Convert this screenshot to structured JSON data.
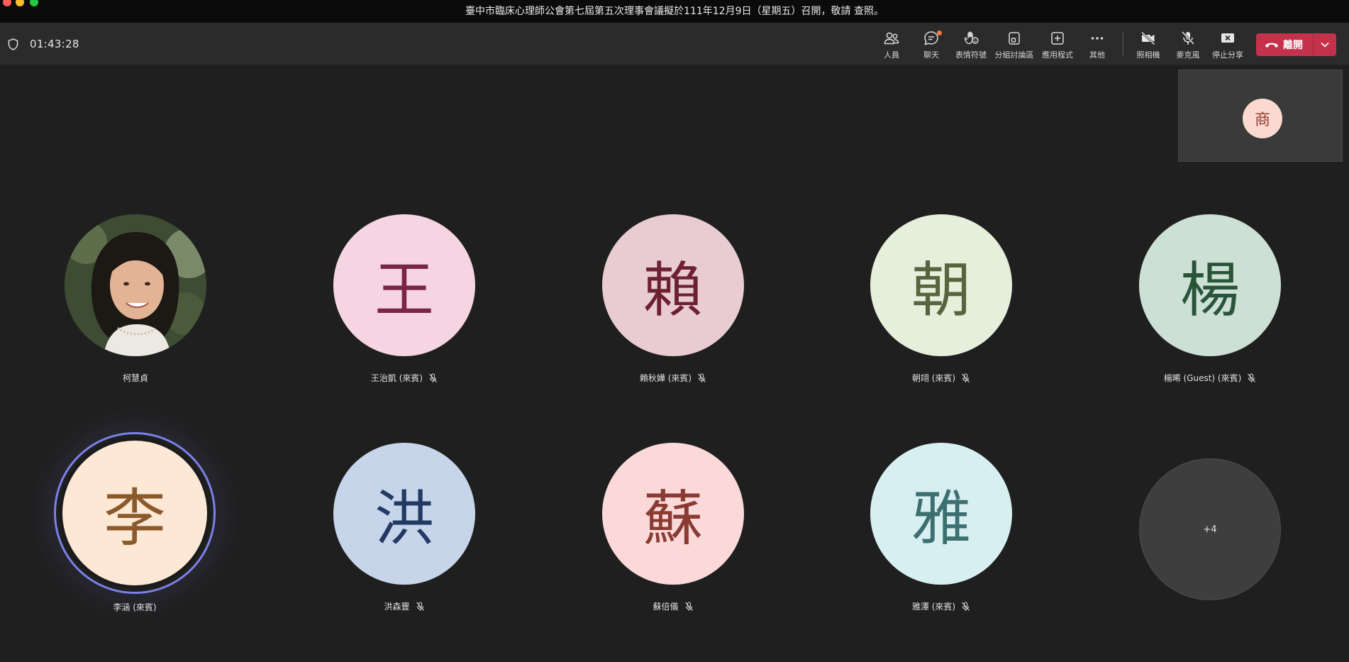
{
  "window": {
    "title": "臺中市臨床心理師公會第七屆第五次理事會議擬於111年12月9日（星期五）召開，敬請 查照。"
  },
  "toolbar": {
    "timer": "01:43:28",
    "items": [
      {
        "label": "人員",
        "icon": "people-icon"
      },
      {
        "label": "聊天",
        "icon": "chat-icon"
      },
      {
        "label": "表情符號",
        "icon": "react-icon"
      },
      {
        "label": "分組討論區",
        "icon": "breakout-rooms-icon"
      },
      {
        "label": "應用程式",
        "icon": "apps-icon"
      },
      {
        "label": "其他",
        "icon": "more-icon"
      },
      {
        "label": "照相機",
        "icon": "camera-off-icon"
      },
      {
        "label": "麥克風",
        "icon": "mic-off-icon"
      },
      {
        "label": "停止分享",
        "icon": "stop-share-icon"
      }
    ],
    "leave_label": "離開"
  },
  "self_view": {
    "initial": "商"
  },
  "participants": [
    {
      "name": "柯慧貞",
      "initial": "",
      "muted": false,
      "bg": "#4b5a3d",
      "fg": "#ffffff",
      "photo": true
    },
    {
      "name": "王治凱 (來賓)",
      "initial": "王",
      "muted": true,
      "bg": "#f5d5e1",
      "fg": "#7a2545"
    },
    {
      "name": "賴秋嬅 (來賓)",
      "initial": "賴",
      "muted": true,
      "bg": "#e8ccd2",
      "fg": "#6d2130"
    },
    {
      "name": "朝翊 (來賓)",
      "initial": "朝",
      "muted": true,
      "bg": "#e6eedc",
      "fg": "#56653e"
    },
    {
      "name": "楊晞 (Guest) (來賓)",
      "initial": "楊",
      "muted": true,
      "bg": "#cde0d5",
      "fg": "#2a5439"
    },
    {
      "name": "李涵 (來賓)",
      "initial": "李",
      "muted": false,
      "bg": "#fde8d6",
      "fg": "#8b5a2b",
      "speaking": true
    },
    {
      "name": "洪森豐",
      "initial": "洪",
      "muted": true,
      "bg": "#c7d5ea",
      "fg": "#233a64"
    },
    {
      "name": "蘇倍儀",
      "initial": "蘇",
      "muted": true,
      "bg": "#fad9d8",
      "fg": "#8a3b34"
    },
    {
      "name": "雅澤 (來賓)",
      "initial": "雅",
      "muted": true,
      "bg": "#d8eff2",
      "fg": "#3b6f70"
    }
  ],
  "overflow": {
    "label": "+4"
  },
  "colors": {
    "background": "#1f1f1f",
    "toolbar": "#2b2b2b",
    "leave_button": "#c4314b",
    "speaking_ring": "#7c80e8"
  }
}
